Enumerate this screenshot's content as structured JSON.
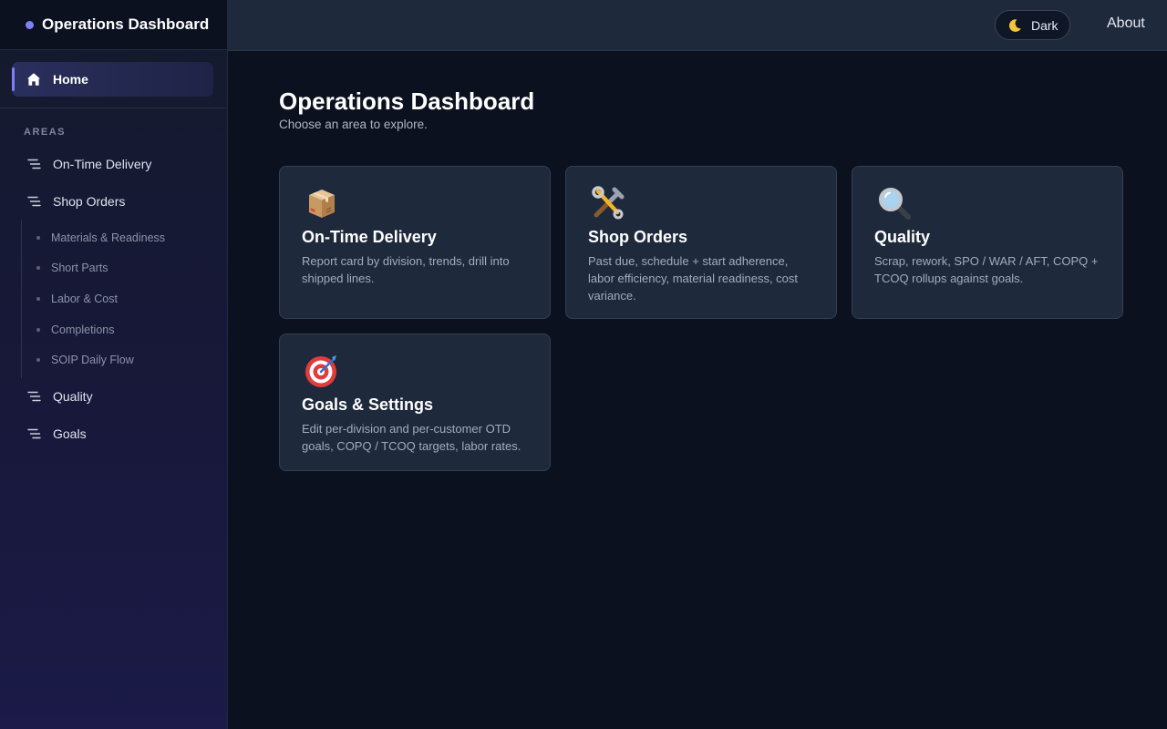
{
  "brand": {
    "title": "Operations Dashboard",
    "accent": "#7d83f5"
  },
  "sidebar": {
    "home": {
      "label": "Home",
      "icon": "home-icon"
    },
    "section_label": "AREAS",
    "items": [
      {
        "label": "On-Time Delivery",
        "icon": "list-icon"
      },
      {
        "label": "Shop Orders",
        "icon": "list-icon",
        "children": [
          {
            "label": "Materials & Readiness"
          },
          {
            "label": "Short Parts"
          },
          {
            "label": "Labor & Cost"
          },
          {
            "label": "Completions"
          },
          {
            "label": "SOIP Daily Flow"
          }
        ]
      },
      {
        "label": "Quality",
        "icon": "list-icon"
      },
      {
        "label": "Goals",
        "icon": "list-icon"
      }
    ]
  },
  "header": {
    "theme_toggle": {
      "label": "Dark",
      "icon": "moon-icon"
    },
    "about_label": "About"
  },
  "main": {
    "title": "Operations Dashboard",
    "subtitle": "Choose an area to explore.",
    "cards": [
      {
        "title": "On-Time Delivery",
        "desc": "Report card by division, trends, drill into shipped lines.",
        "icon": "package-icon"
      },
      {
        "title": "Shop Orders",
        "desc": "Past due, schedule + start adherence, labor efficiency, material readiness, cost variance.",
        "icon": "tools-icon"
      },
      {
        "title": "Quality",
        "desc": "Scrap, rework, SPO / WAR / AFT, COPQ + TCOQ rollups against goals.",
        "icon": "magnifier-icon"
      },
      {
        "title": "Goals & Settings",
        "desc": "Edit per-division and per-customer OTD goals, COPQ / TCOQ targets, labor rates.",
        "icon": "target-icon"
      }
    ]
  }
}
